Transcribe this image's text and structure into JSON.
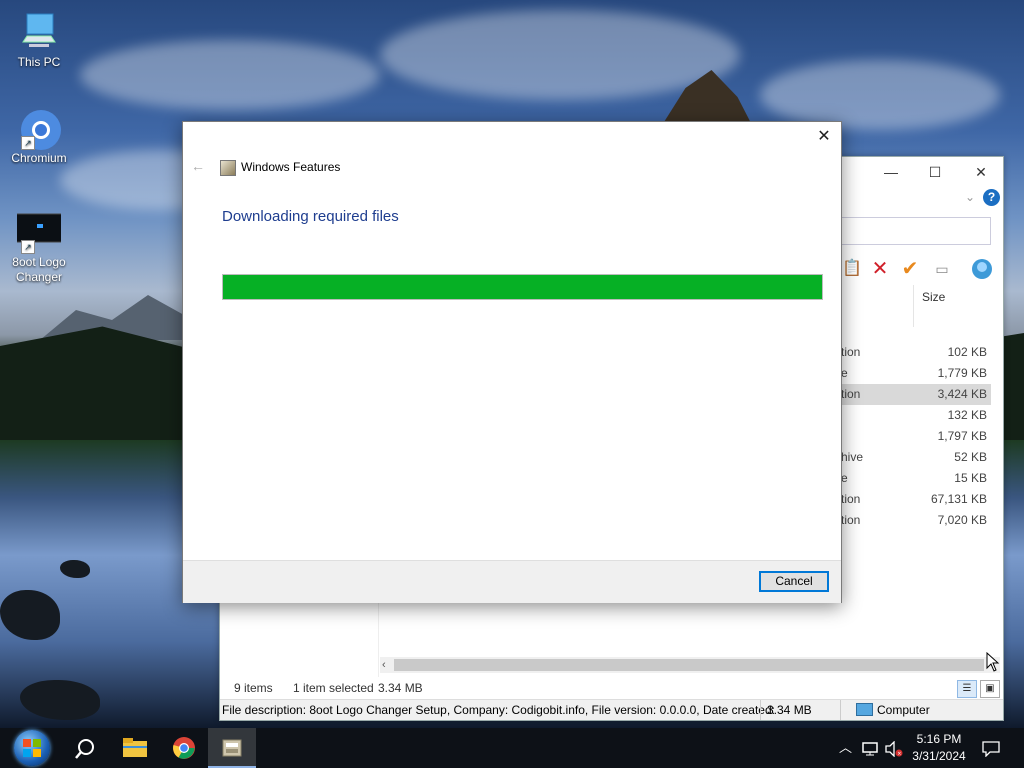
{
  "desktop": {
    "icons": [
      {
        "label": "This PC",
        "icon": "this-pc-icon"
      },
      {
        "label": "Chromium",
        "icon": "chromium-icon"
      },
      {
        "label": "8oot Logo Changer",
        "icon": "boot-logo-changer-icon"
      }
    ]
  },
  "dialog": {
    "title": "Windows Features",
    "heading": "Downloading required files",
    "progress": 1.0,
    "progress_color": "#06b025",
    "cancel_label": "Cancel"
  },
  "explorer": {
    "size_header": "Size",
    "rows": [
      {
        "type": "tion",
        "size": "102 KB"
      },
      {
        "type": "e",
        "size": "1,779 KB"
      },
      {
        "type": "tion",
        "size": "3,424 KB",
        "selected": true
      },
      {
        "type": "",
        "size": "132 KB"
      },
      {
        "type": "",
        "size": "1,797 KB"
      },
      {
        "type": "hive",
        "size": "52 KB"
      },
      {
        "type": "e",
        "size": "15 KB"
      },
      {
        "type": "tion",
        "size": "67,131 KB"
      },
      {
        "type": "tion",
        "size": "7,020 KB"
      }
    ],
    "status": {
      "items": "9 items",
      "selected": "1 item selected",
      "selected_size": "3.34 MB"
    },
    "details_bar": {
      "description": "File description: 8oot Logo Changer Setup, Company: Codigobit.info, File version: 0.0.0.0, Date created:",
      "size": "3.34 MB",
      "location": "Computer"
    }
  },
  "taskbar": {
    "apps": [
      "start-button",
      "search-icon",
      "file-explorer-icon",
      "chrome-icon",
      "windows-features-icon"
    ],
    "time": "5:16 PM",
    "date": "3/31/2024"
  }
}
